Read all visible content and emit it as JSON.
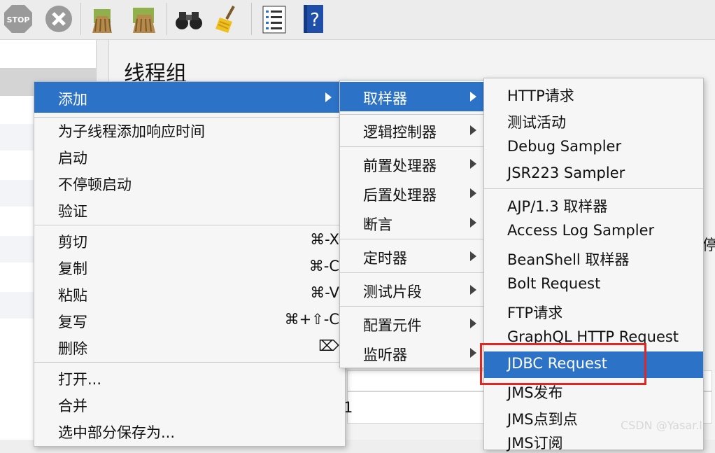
{
  "panel": {
    "title": "线程组",
    "side_text": "停",
    "list_value": "1"
  },
  "menu1": {
    "items": [
      {
        "label": "添加"
      },
      {
        "label": "为子线程添加响应时间"
      },
      {
        "label": "启动"
      },
      {
        "label": "不停顿启动"
      },
      {
        "label": "验证"
      },
      {
        "label": "剪切",
        "shortcut": "⌘-X"
      },
      {
        "label": "复制",
        "shortcut": "⌘-C"
      },
      {
        "label": "粘贴",
        "shortcut": "⌘-V"
      },
      {
        "label": "复写",
        "shortcut": "⌘+⇧-C"
      },
      {
        "label": "删除",
        "shortcut": "⌦"
      },
      {
        "label": "打开..."
      },
      {
        "label": "合并"
      },
      {
        "label": "选中部分保存为..."
      }
    ]
  },
  "menu2": {
    "items": [
      {
        "label": "取样器"
      },
      {
        "label": "逻辑控制器"
      },
      {
        "label": "前置处理器"
      },
      {
        "label": "后置处理器"
      },
      {
        "label": "断言"
      },
      {
        "label": "定时器"
      },
      {
        "label": "测试片段"
      },
      {
        "label": "配置元件"
      },
      {
        "label": "监听器"
      }
    ]
  },
  "menu3": {
    "items": [
      {
        "label": "HTTP请求"
      },
      {
        "label": "测试活动"
      },
      {
        "label": "Debug Sampler"
      },
      {
        "label": "JSR223 Sampler"
      },
      {
        "label": "AJP/1.3 取样器"
      },
      {
        "label": "Access Log Sampler"
      },
      {
        "label": "BeanShell 取样器"
      },
      {
        "label": "Bolt Request"
      },
      {
        "label": "FTP请求"
      },
      {
        "label": "GraphQL HTTP Request"
      },
      {
        "label": "JDBC Request"
      },
      {
        "label": "JMS发布"
      },
      {
        "label": "JMS点到点"
      },
      {
        "label": "JMS订阅"
      }
    ]
  },
  "watermark": "CSDN @Yasar.l",
  "toolbar": {
    "stop_label": "STOP"
  }
}
